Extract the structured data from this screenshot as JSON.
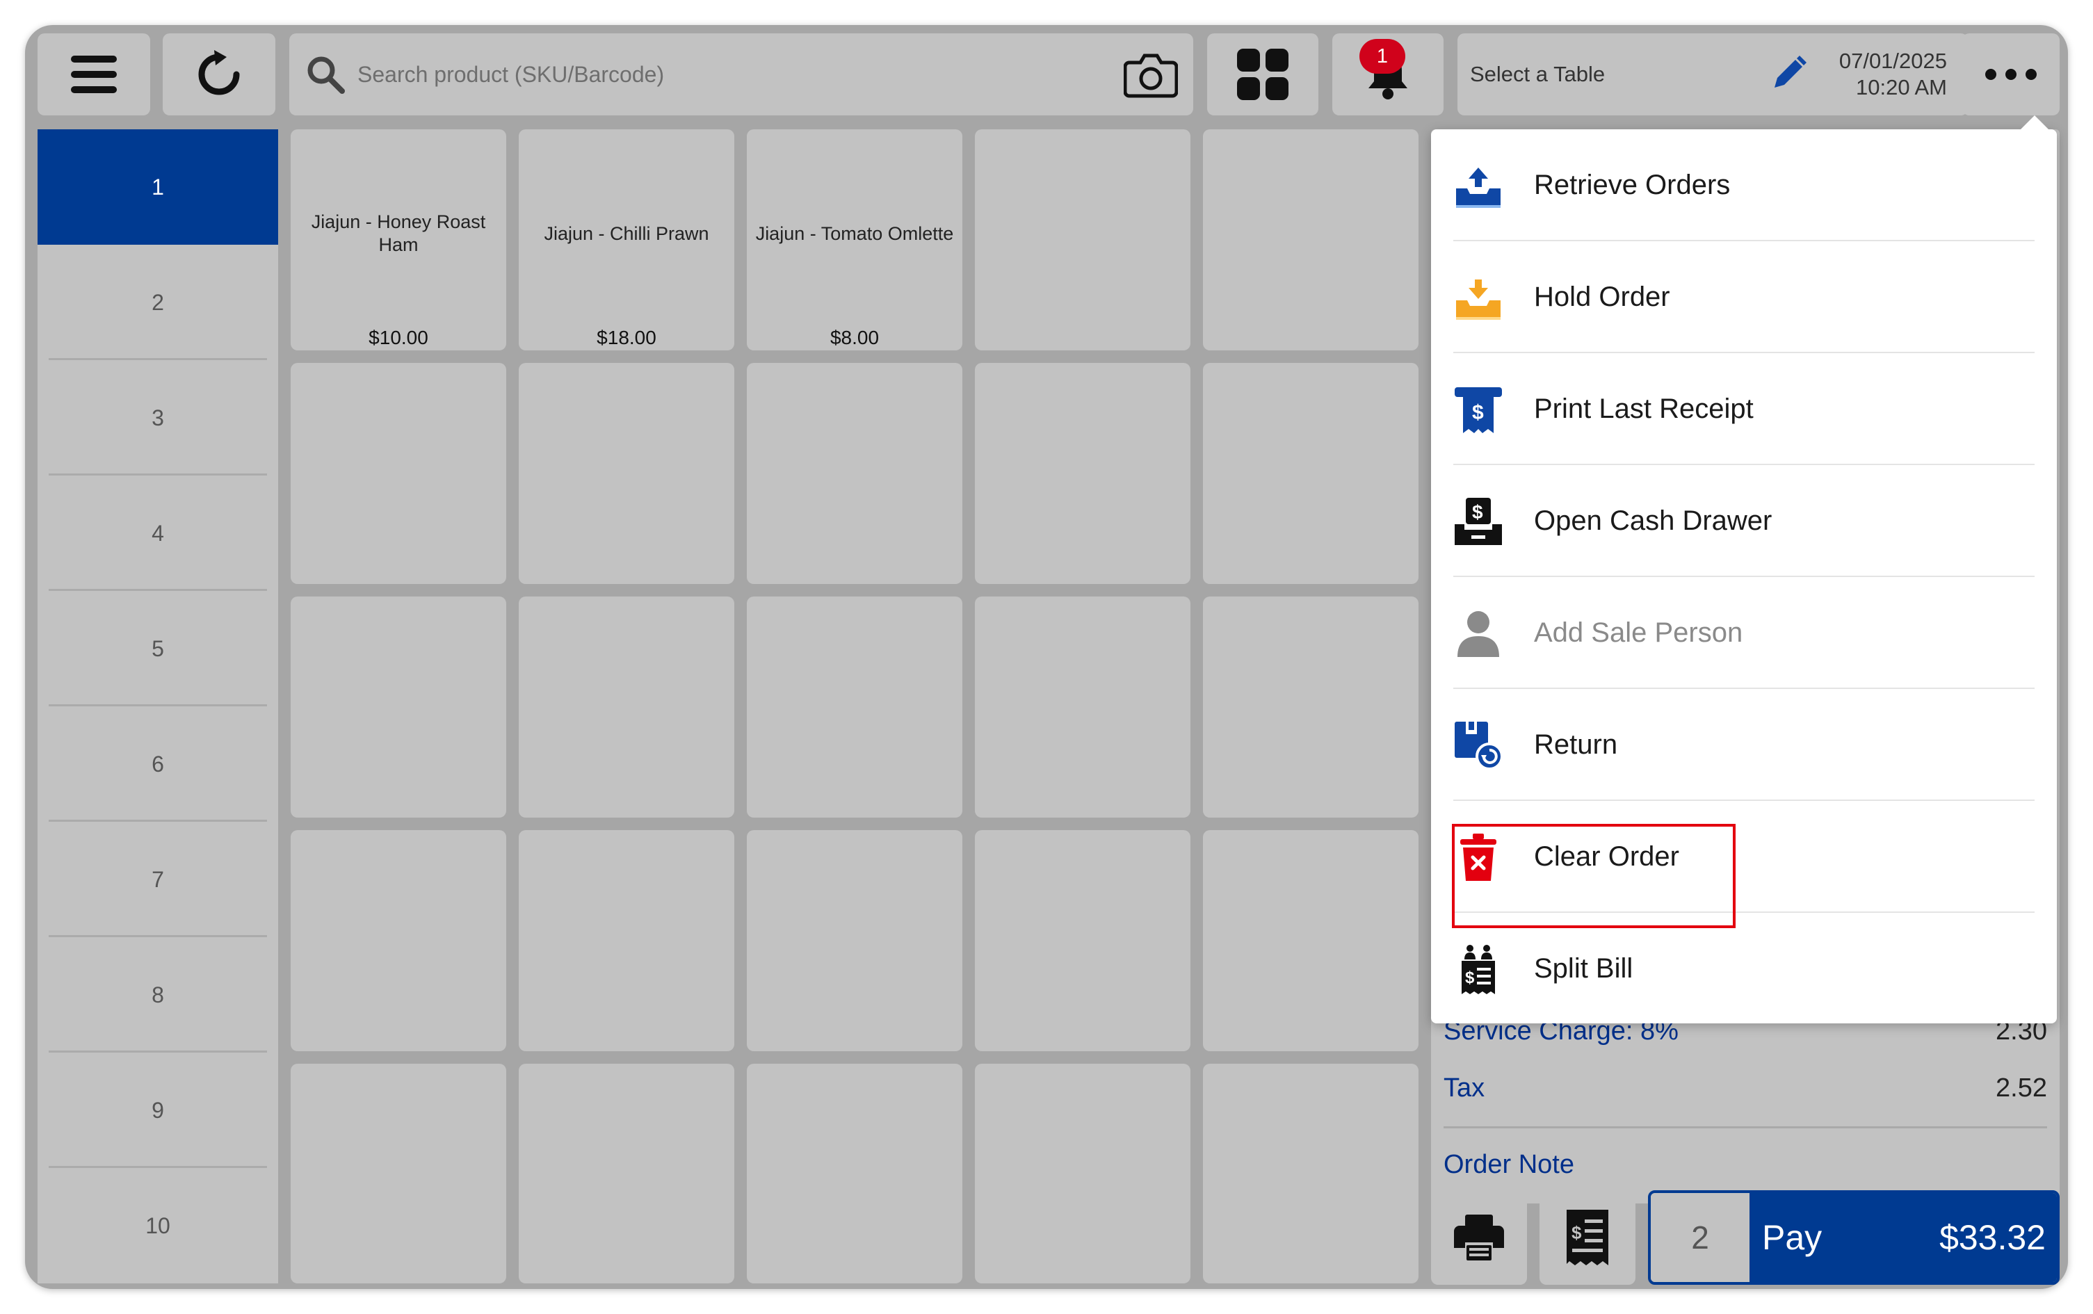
{
  "topbar": {
    "search_placeholder": "Search product (SKU/Barcode)",
    "notification_count": "1",
    "table_label": "Select a Table",
    "date": "07/01/2025",
    "time": "10:20 AM"
  },
  "numbers": {
    "items": [
      "1",
      "2",
      "3",
      "4",
      "5",
      "6",
      "7",
      "8",
      "9",
      "10"
    ],
    "active": "1"
  },
  "products": [
    {
      "name": "Jiajun - Honey Roast Ham",
      "price": "$10.00"
    },
    {
      "name": "Jiajun - Chilli Prawn",
      "price": "$18.00"
    },
    {
      "name": "Jiajun - Tomato Omlette",
      "price": "$8.00"
    }
  ],
  "menu": {
    "items": [
      {
        "label": "Retrieve Orders",
        "icon": "tray-upload-icon"
      },
      {
        "label": "Hold Order",
        "icon": "tray-download-icon"
      },
      {
        "label": "Print Last Receipt",
        "icon": "receipt-dollar-icon"
      },
      {
        "label": "Open Cash Drawer",
        "icon": "cash-drawer-icon"
      },
      {
        "label": "Add Sale Person",
        "icon": "person-icon"
      },
      {
        "label": "Return",
        "icon": "return-box-icon"
      },
      {
        "label": "Clear Order",
        "icon": "trash-x-icon"
      },
      {
        "label": "Split Bill",
        "icon": "split-bill-icon"
      }
    ]
  },
  "cart": {
    "service_charge_label": "Service Charge: 8%",
    "service_charge_value": "2.30",
    "tax_label": "Tax",
    "tax_value": "2.52",
    "order_note_label": "Order Note"
  },
  "footer": {
    "guest_count": "2",
    "pay_label": "Pay",
    "pay_amount": "$33.32"
  },
  "colors": {
    "primary": "#003a91",
    "danger": "#e3000f",
    "accent_orange": "#f5a623",
    "badge": "#d0021b"
  }
}
